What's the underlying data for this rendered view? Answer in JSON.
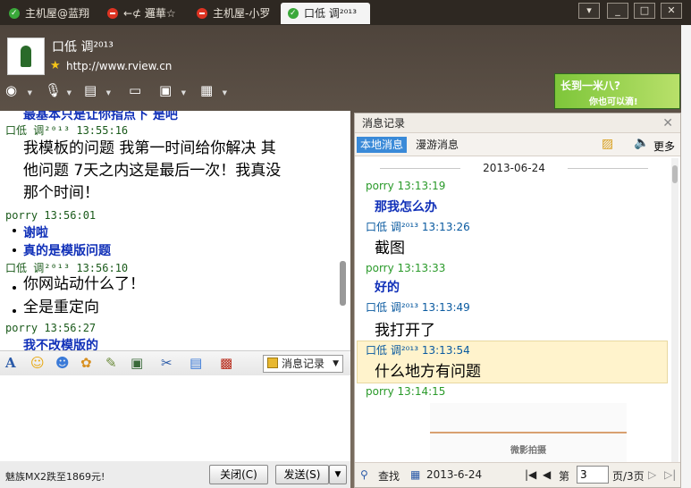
{
  "tabs": [
    {
      "label": "主机屋@蓝翔",
      "icon": "ok"
    },
    {
      "label": "←⊄ 邏華☆",
      "icon": "no"
    },
    {
      "label": "主机屋-小罗",
      "icon": "no"
    },
    {
      "label": "口低 调²⁰¹³",
      "icon": "ok",
      "active": true
    }
  ],
  "window_buttons": {
    "menu": "▾",
    "minimize": "_",
    "maximize": "□",
    "close": "✕"
  },
  "header": {
    "name": "口低 调²⁰¹³",
    "url": "http://www.rview.cn"
  },
  "ad": {
    "line1": "长到一米八?",
    "line2": "你也可以滴!"
  },
  "chat": {
    "partial_top": "最基本只是让你指点下   是吧",
    "m1_head": "口低 调²⁰¹³   13:55:16",
    "m1_body1": "我模板的问题  我第一时间给你解决   其",
    "m1_body2": "他问题   7天之内这是最后一次！我真没",
    "m1_body3": "那个时间！",
    "m2_head": "porry   13:56:01",
    "m2_line1": "谢啦",
    "m2_line2": "真的是模版问题",
    "m3_head": "口低 调²⁰¹³   13:56:10",
    "m3_line1": "你网站动什么了！",
    "m3_line2": "全是重定向",
    "m4_head": "porry   13:56:27",
    "m4_line1": "我不改模版的"
  },
  "input_toolbar": {
    "record_label": "消息记录"
  },
  "bottom": {
    "promo": "魅族MX2跌至1869元!",
    "close_label": "关闭(C)",
    "send_label": "发送(S)"
  },
  "history": {
    "title": "消息记录",
    "tab_local": "本地消息",
    "tab_roam": "漫游消息",
    "more": "更多",
    "date": "2013-06-24",
    "entries": [
      {
        "head": "porry 13:13:19",
        "text": "那我怎么办"
      },
      {
        "head": "口低 调²⁰¹³  13:13:26",
        "text": "截图"
      },
      {
        "head": "porry 13:13:33",
        "text": "好的"
      },
      {
        "head": "口低 调²⁰¹³  13:13:49",
        "text": "我打开了"
      },
      {
        "head": "口低 调²⁰¹³  13:13:54",
        "text": "什么地方有问题"
      },
      {
        "head": "porry 13:14:15",
        "text": ""
      }
    ],
    "thumb_label": "微影拍摄",
    "search_label": "查找",
    "footer_date": "2013-6-24",
    "page_prefix": "第",
    "page_value": "3",
    "page_suffix": "页/3页"
  }
}
